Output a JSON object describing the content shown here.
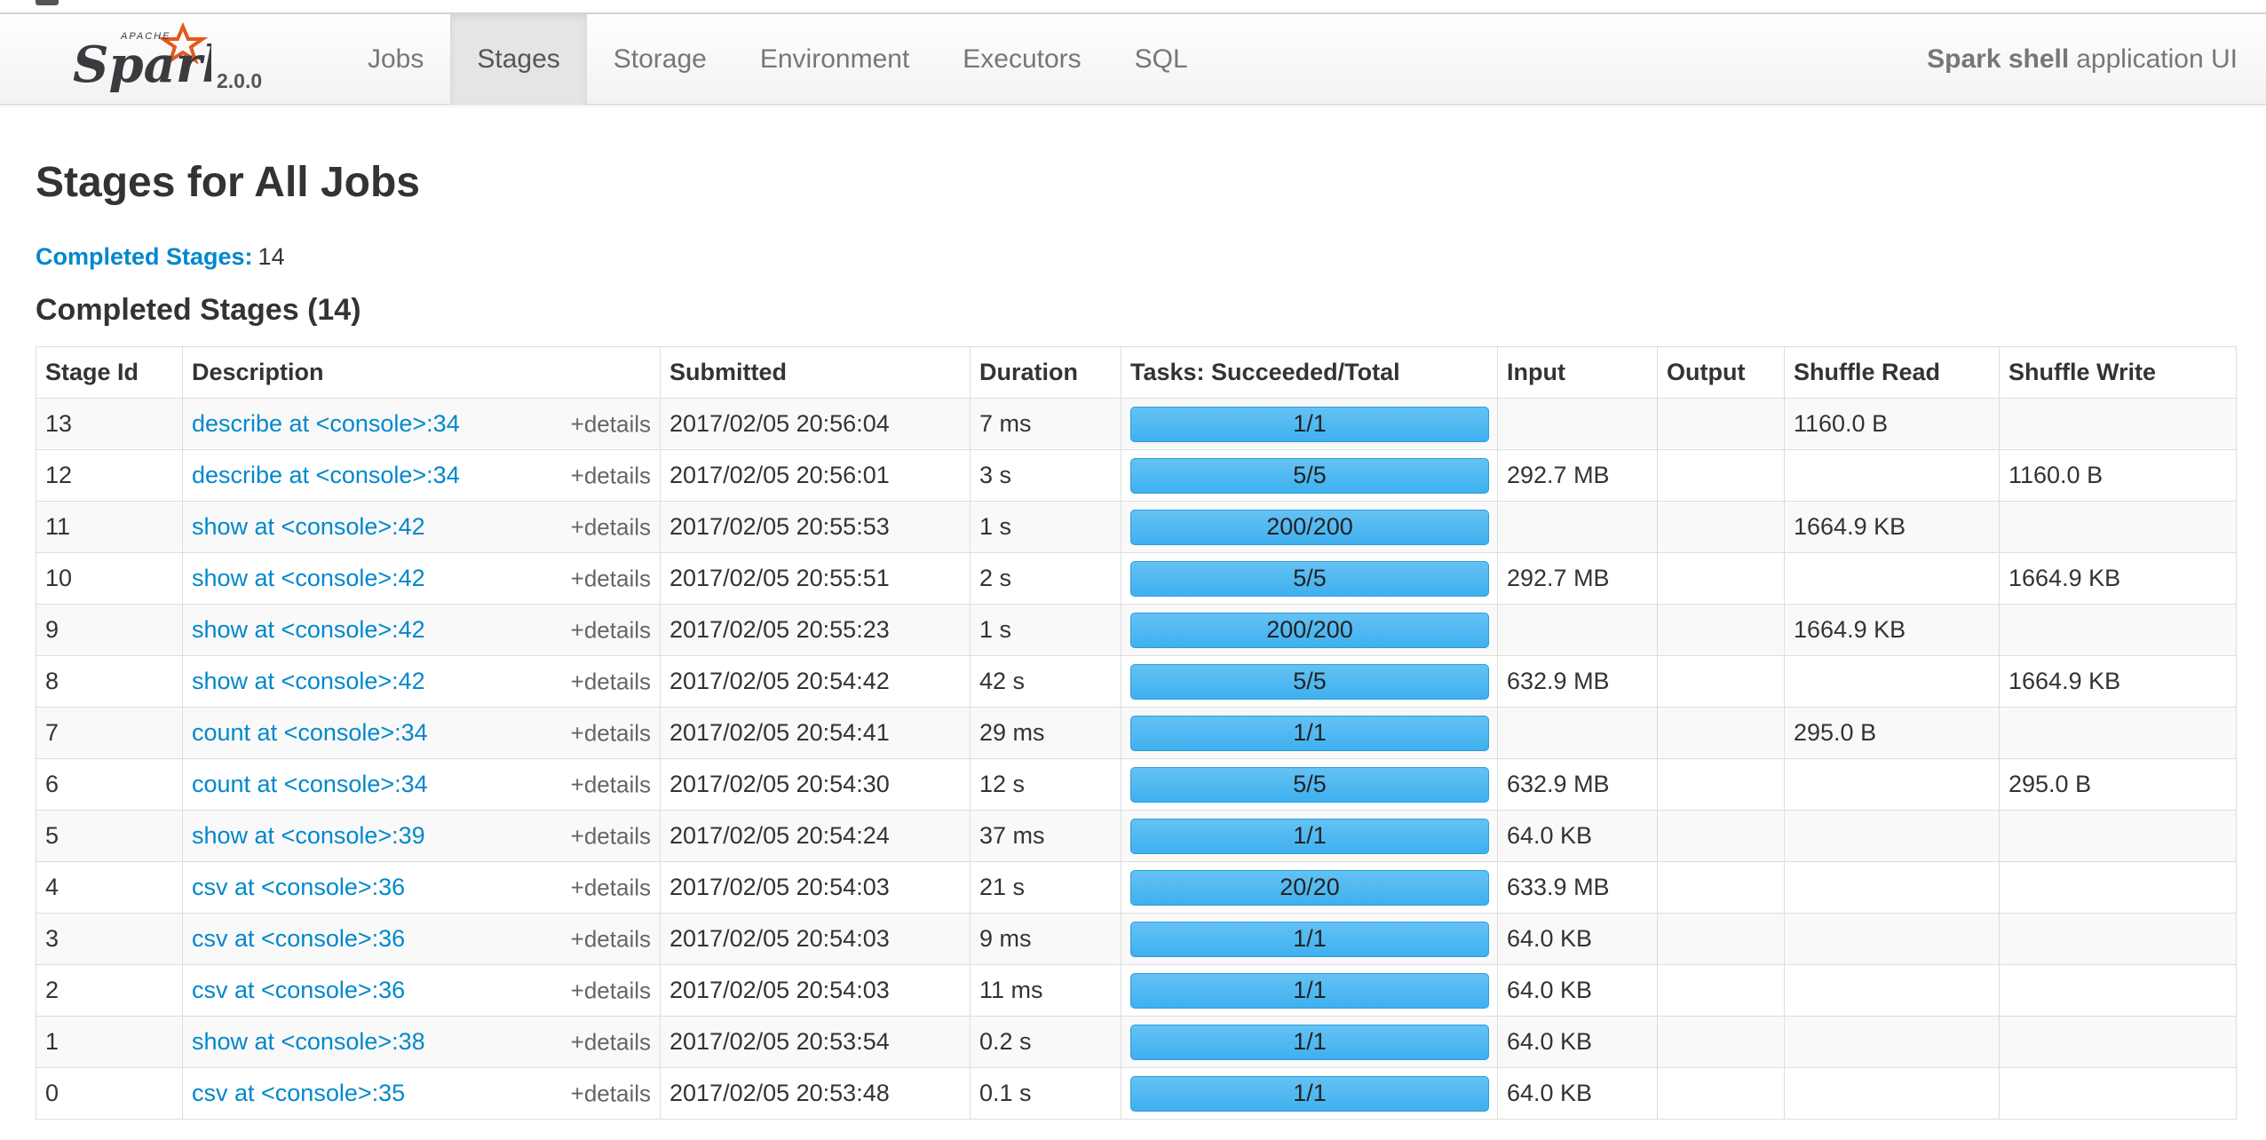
{
  "brand": {
    "name": "Spark",
    "apache": "APACHE",
    "version": "2.0.0",
    "accent": "#e25a1c"
  },
  "nav": {
    "items": [
      {
        "label": "Jobs"
      },
      {
        "label": "Stages",
        "active": true
      },
      {
        "label": "Storage"
      },
      {
        "label": "Environment"
      },
      {
        "label": "Executors"
      },
      {
        "label": "SQL"
      }
    ],
    "app_title_bold": "Spark shell",
    "app_title_rest": "application UI"
  },
  "page": {
    "title": "Stages for All Jobs",
    "summary_label": "Completed Stages:",
    "summary_count": "14",
    "section_title": "Completed Stages (14)"
  },
  "table": {
    "headers": [
      "Stage Id",
      "Description",
      "Submitted",
      "Duration",
      "Tasks: Succeeded/Total",
      "Input",
      "Output",
      "Shuffle Read",
      "Shuffle Write"
    ],
    "details_label": "+details",
    "progress_color": "#4bb5f0",
    "rows": [
      {
        "id": "13",
        "desc": "describe at <console>:34",
        "submitted": "2017/02/05 20:56:04",
        "duration": "7 ms",
        "tasks": "1/1",
        "input": "",
        "output": "",
        "shuffle_read": "1160.0 B",
        "shuffle_write": ""
      },
      {
        "id": "12",
        "desc": "describe at <console>:34",
        "submitted": "2017/02/05 20:56:01",
        "duration": "3 s",
        "tasks": "5/5",
        "input": "292.7 MB",
        "output": "",
        "shuffle_read": "",
        "shuffle_write": "1160.0 B"
      },
      {
        "id": "11",
        "desc": "show at <console>:42",
        "submitted": "2017/02/05 20:55:53",
        "duration": "1 s",
        "tasks": "200/200",
        "input": "",
        "output": "",
        "shuffle_read": "1664.9 KB",
        "shuffle_write": ""
      },
      {
        "id": "10",
        "desc": "show at <console>:42",
        "submitted": "2017/02/05 20:55:51",
        "duration": "2 s",
        "tasks": "5/5",
        "input": "292.7 MB",
        "output": "",
        "shuffle_read": "",
        "shuffle_write": "1664.9 KB"
      },
      {
        "id": "9",
        "desc": "show at <console>:42",
        "submitted": "2017/02/05 20:55:23",
        "duration": "1 s",
        "tasks": "200/200",
        "input": "",
        "output": "",
        "shuffle_read": "1664.9 KB",
        "shuffle_write": ""
      },
      {
        "id": "8",
        "desc": "show at <console>:42",
        "submitted": "2017/02/05 20:54:42",
        "duration": "42 s",
        "tasks": "5/5",
        "input": "632.9 MB",
        "output": "",
        "shuffle_read": "",
        "shuffle_write": "1664.9 KB"
      },
      {
        "id": "7",
        "desc": "count at <console>:34",
        "submitted": "2017/02/05 20:54:41",
        "duration": "29 ms",
        "tasks": "1/1",
        "input": "",
        "output": "",
        "shuffle_read": "295.0 B",
        "shuffle_write": ""
      },
      {
        "id": "6",
        "desc": "count at <console>:34",
        "submitted": "2017/02/05 20:54:30",
        "duration": "12 s",
        "tasks": "5/5",
        "input": "632.9 MB",
        "output": "",
        "shuffle_read": "",
        "shuffle_write": "295.0 B"
      },
      {
        "id": "5",
        "desc": "show at <console>:39",
        "submitted": "2017/02/05 20:54:24",
        "duration": "37 ms",
        "tasks": "1/1",
        "input": "64.0 KB",
        "output": "",
        "shuffle_read": "",
        "shuffle_write": ""
      },
      {
        "id": "4",
        "desc": "csv at <console>:36",
        "submitted": "2017/02/05 20:54:03",
        "duration": "21 s",
        "tasks": "20/20",
        "input": "633.9 MB",
        "output": "",
        "shuffle_read": "",
        "shuffle_write": ""
      },
      {
        "id": "3",
        "desc": "csv at <console>:36",
        "submitted": "2017/02/05 20:54:03",
        "duration": "9 ms",
        "tasks": "1/1",
        "input": "64.0 KB",
        "output": "",
        "shuffle_read": "",
        "shuffle_write": ""
      },
      {
        "id": "2",
        "desc": "csv at <console>:36",
        "submitted": "2017/02/05 20:54:03",
        "duration": "11 ms",
        "tasks": "1/1",
        "input": "64.0 KB",
        "output": "",
        "shuffle_read": "",
        "shuffle_write": ""
      },
      {
        "id": "1",
        "desc": "show at <console>:38",
        "submitted": "2017/02/05 20:53:54",
        "duration": "0.2 s",
        "tasks": "1/1",
        "input": "64.0 KB",
        "output": "",
        "shuffle_read": "",
        "shuffle_write": ""
      },
      {
        "id": "0",
        "desc": "csv at <console>:35",
        "submitted": "2017/02/05 20:53:48",
        "duration": "0.1 s",
        "tasks": "1/1",
        "input": "64.0 KB",
        "output": "",
        "shuffle_read": "",
        "shuffle_write": ""
      }
    ]
  }
}
